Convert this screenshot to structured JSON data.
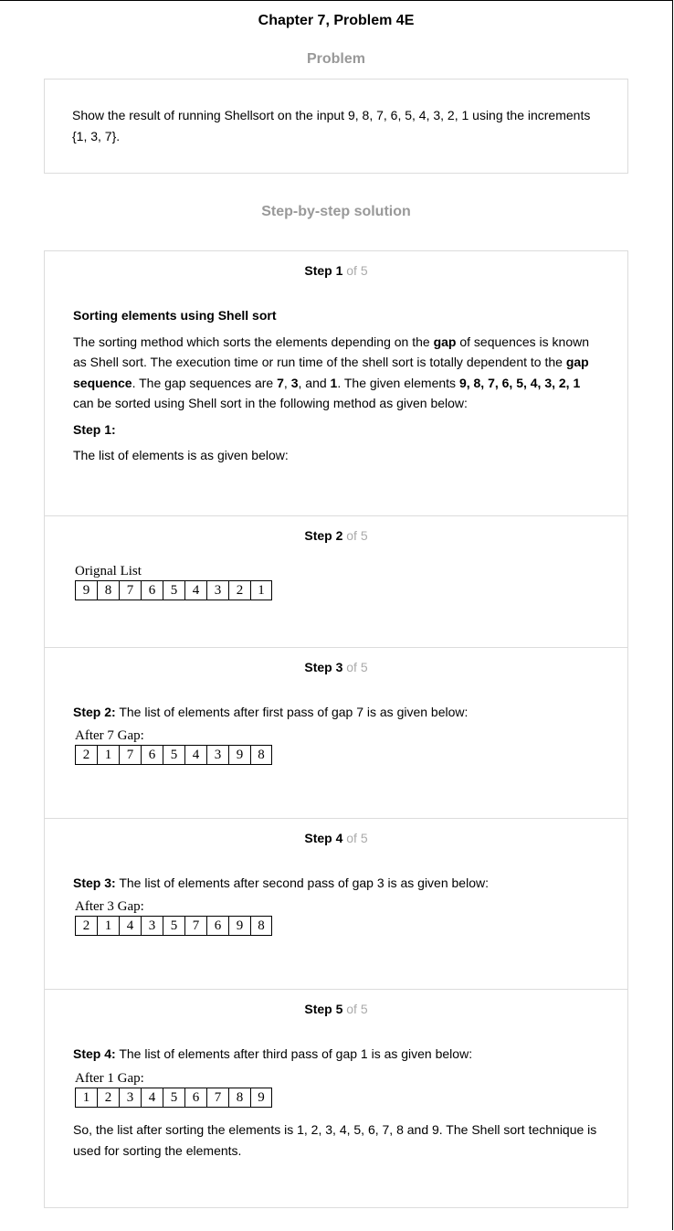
{
  "header": {
    "title": "Chapter 7, Problem 4E"
  },
  "problem": {
    "heading": "Problem",
    "text": "Show the result of running Shellsort on the input 9, 8, 7, 6, 5, 4, 3, 2, 1 using the increments {1, 3, 7}."
  },
  "solution": {
    "heading": "Step-by-step solution",
    "of_total": "of 5",
    "steps": [
      {
        "label": "Step 1",
        "subheading": "Sorting elements using Shell sort",
        "para": {
          "t1": "The sorting method which sorts the elements depending on the ",
          "b1": "gap",
          "t2": " of sequences is known as Shell sort. The execution time or run time of the shell sort is totally dependent to the ",
          "b2": "gap sequence",
          "t3": ". The gap sequences are ",
          "b3": "7",
          "t4": ", ",
          "b4": "3",
          "t5": ", and ",
          "b5": "1",
          "t6": ". The given elements ",
          "b6": "9, 8, 7, 6, 5, 4, 3, 2, 1",
          "t7": " can be sorted using Shell sort in the following method as given below:"
        },
        "sub_label": "Step 1:",
        "text": "The list of elements is as given below:"
      },
      {
        "label": "Step 2",
        "figure": {
          "label": "Orignal List",
          "values": [
            "9",
            "8",
            "7",
            "6",
            "5",
            "4",
            "3",
            "2",
            "1"
          ]
        }
      },
      {
        "label": "Step 3",
        "sub_label": "Step 2:",
        "text": " The list of elements after first pass of gap 7 is as given below:",
        "figure": {
          "label": "After 7 Gap:",
          "values": [
            "2",
            "1",
            "7",
            "6",
            "5",
            "4",
            "3",
            "9",
            "8"
          ]
        }
      },
      {
        "label": "Step 4",
        "sub_label": "Step 3:",
        "text": " The list of elements after second pass of gap 3 is as given below:",
        "figure": {
          "label": "After 3 Gap:",
          "values": [
            "2",
            "1",
            "4",
            "3",
            "5",
            "7",
            "6",
            "9",
            "8"
          ]
        }
      },
      {
        "label": "Step 5",
        "sub_label": "Step 4:",
        "text": " The list of elements after third pass of gap 1 is as given below:",
        "figure": {
          "label": "After 1 Gap:",
          "values": [
            "1",
            "2",
            "3",
            "4",
            "5",
            "6",
            "7",
            "8",
            "9"
          ]
        },
        "conclusion": "So, the list after sorting the elements is 1, 2, 3, 4, 5, 6, 7, 8 and 9. The Shell sort technique is used for sorting the elements."
      }
    ]
  }
}
